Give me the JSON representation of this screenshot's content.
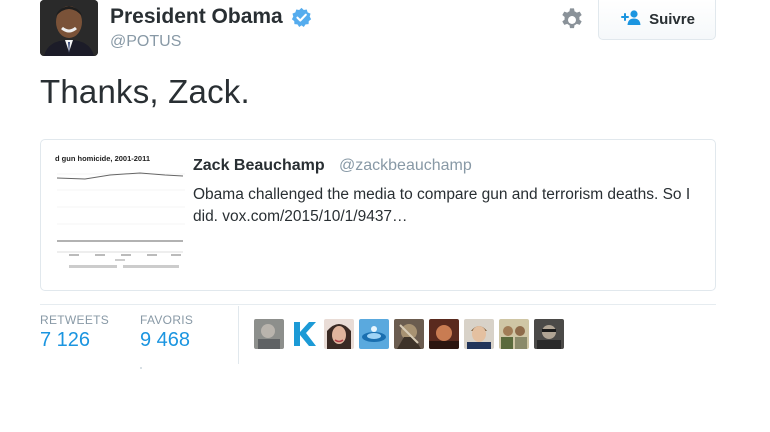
{
  "author": {
    "name": "President Obama",
    "handle": "@POTUS"
  },
  "actions": {
    "follow_label": "Suivre"
  },
  "tweet": {
    "text": "Thanks, Zack."
  },
  "quoted": {
    "name": "Zack Beauchamp",
    "handle": "@zackbeauchamp",
    "text": "Obama challenged the media to compare gun and terrorism deaths. So I did. vox.com/2015/10/1/9437…",
    "thumbnail_title": "d gun homicide, 2001-2011"
  },
  "stats": {
    "retweets_label": "RETWEETS",
    "retweets_value": "7 126",
    "favorites_label": "FAVORIS",
    "favorites_value": "9 468"
  },
  "colors": {
    "link_blue": "#1b95e0",
    "verified_blue": "#55acee",
    "muted_gray": "#8899a6",
    "text_dark": "#292f33"
  },
  "icons": [
    "verified-badge-icon",
    "gear-icon",
    "follow-user-icon"
  ],
  "favoriters_count_shown": 9
}
